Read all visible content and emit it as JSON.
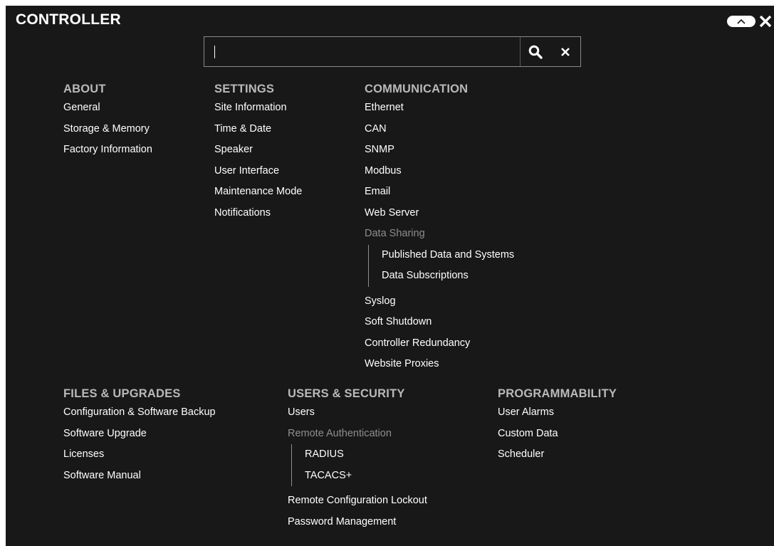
{
  "header": {
    "title": "CONTROLLER"
  },
  "search": {
    "value": "",
    "placeholder": ""
  },
  "icons": {
    "collapse": "chevron-up-icon",
    "close": "close-icon",
    "search": "search-icon",
    "clear": "clear-icon"
  },
  "colors": {
    "panel_bg": "#181818",
    "heading": "#b9b9b9",
    "item": "#ffffff",
    "disabled_group": "#8e8e8e"
  },
  "sections": {
    "about": {
      "heading": "ABOUT",
      "items": [
        "General",
        "Storage & Memory",
        "Factory Information"
      ]
    },
    "settings": {
      "heading": "SETTINGS",
      "items": [
        "Site Information",
        "Time & Date",
        "Speaker",
        "User Interface",
        "Maintenance Mode",
        "Notifications"
      ]
    },
    "communication": {
      "heading": "COMMUNICATION",
      "items_before": [
        "Ethernet",
        "CAN",
        "SNMP",
        "Modbus",
        "Email",
        "Web Server"
      ],
      "group_label": "Data Sharing",
      "group_items": [
        "Published Data and Systems",
        "Data Subscriptions"
      ],
      "items_after": [
        "Syslog",
        "Soft Shutdown",
        "Controller Redundancy",
        "Website Proxies"
      ]
    },
    "files": {
      "heading": "FILES & UPGRADES",
      "items": [
        "Configuration & Software Backup",
        "Software Upgrade",
        "Licenses",
        "Software Manual"
      ]
    },
    "users": {
      "heading": "USERS & SECURITY",
      "items_before": [
        "Users"
      ],
      "group_label": "Remote Authentication",
      "group_items": [
        "RADIUS",
        "TACACS+"
      ],
      "items_after": [
        "Remote Configuration Lockout",
        "Password Management"
      ]
    },
    "programmability": {
      "heading": "PROGRAMMABILITY",
      "items": [
        "User Alarms",
        "Custom Data",
        "Scheduler"
      ]
    }
  }
}
